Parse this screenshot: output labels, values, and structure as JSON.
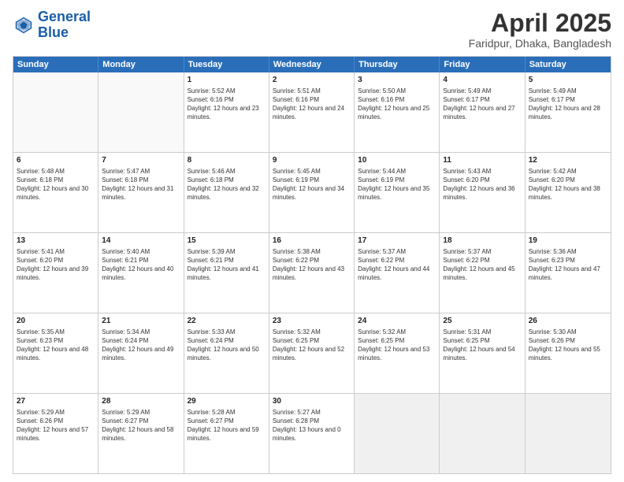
{
  "header": {
    "logo_general": "General",
    "logo_blue": "Blue",
    "title": "April 2025",
    "subtitle": "Faridpur, Dhaka, Bangladesh"
  },
  "days_of_week": [
    "Sunday",
    "Monday",
    "Tuesday",
    "Wednesday",
    "Thursday",
    "Friday",
    "Saturday"
  ],
  "weeks": [
    [
      {
        "day": "",
        "sunrise": "",
        "sunset": "",
        "daylight": "",
        "empty": true
      },
      {
        "day": "",
        "sunrise": "",
        "sunset": "",
        "daylight": "",
        "empty": true
      },
      {
        "day": "1",
        "sunrise": "Sunrise: 5:52 AM",
        "sunset": "Sunset: 6:16 PM",
        "daylight": "Daylight: 12 hours and 23 minutes."
      },
      {
        "day": "2",
        "sunrise": "Sunrise: 5:51 AM",
        "sunset": "Sunset: 6:16 PM",
        "daylight": "Daylight: 12 hours and 24 minutes."
      },
      {
        "day": "3",
        "sunrise": "Sunrise: 5:50 AM",
        "sunset": "Sunset: 6:16 PM",
        "daylight": "Daylight: 12 hours and 25 minutes."
      },
      {
        "day": "4",
        "sunrise": "Sunrise: 5:49 AM",
        "sunset": "Sunset: 6:17 PM",
        "daylight": "Daylight: 12 hours and 27 minutes."
      },
      {
        "day": "5",
        "sunrise": "Sunrise: 5:49 AM",
        "sunset": "Sunset: 6:17 PM",
        "daylight": "Daylight: 12 hours and 28 minutes."
      }
    ],
    [
      {
        "day": "6",
        "sunrise": "Sunrise: 5:48 AM",
        "sunset": "Sunset: 6:18 PM",
        "daylight": "Daylight: 12 hours and 30 minutes."
      },
      {
        "day": "7",
        "sunrise": "Sunrise: 5:47 AM",
        "sunset": "Sunset: 6:18 PM",
        "daylight": "Daylight: 12 hours and 31 minutes."
      },
      {
        "day": "8",
        "sunrise": "Sunrise: 5:46 AM",
        "sunset": "Sunset: 6:18 PM",
        "daylight": "Daylight: 12 hours and 32 minutes."
      },
      {
        "day": "9",
        "sunrise": "Sunrise: 5:45 AM",
        "sunset": "Sunset: 6:19 PM",
        "daylight": "Daylight: 12 hours and 34 minutes."
      },
      {
        "day": "10",
        "sunrise": "Sunrise: 5:44 AM",
        "sunset": "Sunset: 6:19 PM",
        "daylight": "Daylight: 12 hours and 35 minutes."
      },
      {
        "day": "11",
        "sunrise": "Sunrise: 5:43 AM",
        "sunset": "Sunset: 6:20 PM",
        "daylight": "Daylight: 12 hours and 36 minutes."
      },
      {
        "day": "12",
        "sunrise": "Sunrise: 5:42 AM",
        "sunset": "Sunset: 6:20 PM",
        "daylight": "Daylight: 12 hours and 38 minutes."
      }
    ],
    [
      {
        "day": "13",
        "sunrise": "Sunrise: 5:41 AM",
        "sunset": "Sunset: 6:20 PM",
        "daylight": "Daylight: 12 hours and 39 minutes."
      },
      {
        "day": "14",
        "sunrise": "Sunrise: 5:40 AM",
        "sunset": "Sunset: 6:21 PM",
        "daylight": "Daylight: 12 hours and 40 minutes."
      },
      {
        "day": "15",
        "sunrise": "Sunrise: 5:39 AM",
        "sunset": "Sunset: 6:21 PM",
        "daylight": "Daylight: 12 hours and 41 minutes."
      },
      {
        "day": "16",
        "sunrise": "Sunrise: 5:38 AM",
        "sunset": "Sunset: 6:22 PM",
        "daylight": "Daylight: 12 hours and 43 minutes."
      },
      {
        "day": "17",
        "sunrise": "Sunrise: 5:37 AM",
        "sunset": "Sunset: 6:22 PM",
        "daylight": "Daylight: 12 hours and 44 minutes."
      },
      {
        "day": "18",
        "sunrise": "Sunrise: 5:37 AM",
        "sunset": "Sunset: 6:22 PM",
        "daylight": "Daylight: 12 hours and 45 minutes."
      },
      {
        "day": "19",
        "sunrise": "Sunrise: 5:36 AM",
        "sunset": "Sunset: 6:23 PM",
        "daylight": "Daylight: 12 hours and 47 minutes."
      }
    ],
    [
      {
        "day": "20",
        "sunrise": "Sunrise: 5:35 AM",
        "sunset": "Sunset: 6:23 PM",
        "daylight": "Daylight: 12 hours and 48 minutes."
      },
      {
        "day": "21",
        "sunrise": "Sunrise: 5:34 AM",
        "sunset": "Sunset: 6:24 PM",
        "daylight": "Daylight: 12 hours and 49 minutes."
      },
      {
        "day": "22",
        "sunrise": "Sunrise: 5:33 AM",
        "sunset": "Sunset: 6:24 PM",
        "daylight": "Daylight: 12 hours and 50 minutes."
      },
      {
        "day": "23",
        "sunrise": "Sunrise: 5:32 AM",
        "sunset": "Sunset: 6:25 PM",
        "daylight": "Daylight: 12 hours and 52 minutes."
      },
      {
        "day": "24",
        "sunrise": "Sunrise: 5:32 AM",
        "sunset": "Sunset: 6:25 PM",
        "daylight": "Daylight: 12 hours and 53 minutes."
      },
      {
        "day": "25",
        "sunrise": "Sunrise: 5:31 AM",
        "sunset": "Sunset: 6:25 PM",
        "daylight": "Daylight: 12 hours and 54 minutes."
      },
      {
        "day": "26",
        "sunrise": "Sunrise: 5:30 AM",
        "sunset": "Sunset: 6:26 PM",
        "daylight": "Daylight: 12 hours and 55 minutes."
      }
    ],
    [
      {
        "day": "27",
        "sunrise": "Sunrise: 5:29 AM",
        "sunset": "Sunset: 6:26 PM",
        "daylight": "Daylight: 12 hours and 57 minutes."
      },
      {
        "day": "28",
        "sunrise": "Sunrise: 5:29 AM",
        "sunset": "Sunset: 6:27 PM",
        "daylight": "Daylight: 12 hours and 58 minutes."
      },
      {
        "day": "29",
        "sunrise": "Sunrise: 5:28 AM",
        "sunset": "Sunset: 6:27 PM",
        "daylight": "Daylight: 12 hours and 59 minutes."
      },
      {
        "day": "30",
        "sunrise": "Sunrise: 5:27 AM",
        "sunset": "Sunset: 6:28 PM",
        "daylight": "Daylight: 13 hours and 0 minutes."
      },
      {
        "day": "",
        "sunrise": "",
        "sunset": "",
        "daylight": "",
        "empty": true,
        "shaded": true
      },
      {
        "day": "",
        "sunrise": "",
        "sunset": "",
        "daylight": "",
        "empty": true,
        "shaded": true
      },
      {
        "day": "",
        "sunrise": "",
        "sunset": "",
        "daylight": "",
        "empty": true,
        "shaded": true
      }
    ]
  ]
}
